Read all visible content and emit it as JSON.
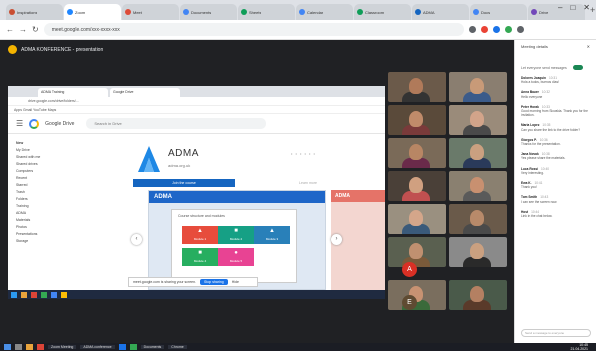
{
  "browser": {
    "tabs": [
      {
        "label": "Inspirations",
        "color": "#c94e32"
      },
      {
        "label": "Zoom",
        "color": "#1f86ff"
      },
      {
        "label": "Meet",
        "color": "#dd4b39"
      },
      {
        "label": "Documents",
        "color": "#4285f4"
      },
      {
        "label": "Sheets",
        "color": "#0f9d58"
      },
      {
        "label": "Calendar",
        "color": "#4285f4"
      },
      {
        "label": "Classroom",
        "color": "#0f9d58"
      },
      {
        "label": "ADMA",
        "color": "#1565c0"
      },
      {
        "label": "Docs",
        "color": "#4285f4"
      },
      {
        "label": "Drive",
        "color": "#7248b9"
      }
    ],
    "url": "meet.google.com/xxx-xxxx-xxx"
  },
  "meet": {
    "title": "ADMA KONFERENCE - presentation",
    "shared": {
      "tabs": [
        "ADMA Training",
        "Google Drive"
      ],
      "url": "drive.google.com/drive/folders/...",
      "bookmarks": "Apps   Gmail   YouTube   Maps",
      "drive_name": "Google Drive",
      "search_placeholder": "Search in Drive",
      "sidebar": [
        "New",
        "My Drive",
        "Shared with me",
        "Shared drives",
        "Computers",
        "Recent",
        "Starred",
        "Trash",
        "Folders",
        "Training",
        "ADMA",
        "Materials",
        "Photos",
        "Presentations",
        "Storage"
      ],
      "brand": "ADMA",
      "brand_sub": "adma.org.uk",
      "stat": "• • • •  • •",
      "primary_button": "Join the course",
      "secondary_button": "Learn more",
      "slide_header": "ADMA",
      "slide_panel_title": "Course structure and modules",
      "tiles": [
        {
          "label": "Module 1",
          "color": "#e74c3c",
          "icon": "▲"
        },
        {
          "label": "Module 2",
          "color": "#16a085",
          "icon": "■"
        },
        {
          "label": "Module 3",
          "color": "#2980b9",
          "icon": "▲"
        },
        {
          "label": "Module 4",
          "color": "#27ae60",
          "icon": "■"
        },
        {
          "label": "Module 5",
          "color": "#e84393",
          "icon": "●"
        }
      ],
      "slide2_header": "ADMA",
      "notif_text": "meet.google.com is sharing your screen.",
      "notif_button": "Stop sharing",
      "notif_hide": "Hide"
    },
    "participants": [
      {
        "skin": "#b07a5a",
        "bg": "#6b5a4a",
        "shirt": "#333"
      },
      {
        "skin": "#c89a78",
        "bg": "#8a7e70",
        "shirt": "#3b5b8a"
      },
      {
        "skin": "#c08b6a",
        "bg": "#5a4a3a",
        "shirt": "#7a3a3a"
      },
      {
        "skin": "#d2a48a",
        "bg": "#9a8b7a",
        "shirt": "#4a4a4a"
      },
      {
        "skin": "#b88664",
        "bg": "#7a6a58",
        "shirt": "#6a2a4a"
      },
      {
        "skin": "#caa080",
        "bg": "#6a7a6a",
        "shirt": "#2a3a5a"
      },
      {
        "skin": "#d0a080",
        "bg": "#4a4038",
        "shirt": "#c05050"
      },
      {
        "skin": "#c89070",
        "bg": "#8a8070",
        "shirt": "#5a5a5a"
      },
      {
        "skin": "#d4a68a",
        "bg": "#9a9080",
        "shirt": "#3a5a7a"
      },
      {
        "skin": "#b88a6a",
        "bg": "#6a5a4a",
        "shirt": "#4a4a4a"
      },
      {
        "skin": "#c09070",
        "bg": "#5a6050",
        "shirt": "#7a5a3a"
      },
      {
        "skin": "#caa080",
        "bg": "#8a8a8a",
        "shirt": "#2a2a2a"
      },
      {
        "skin": "#c89272",
        "bg": "#7a6e5e",
        "shirt": "#3a6a3a"
      },
      {
        "skin": "#b48062",
        "bg": "#4a5a4a",
        "shirt": "#5a3a2a"
      }
    ],
    "avatars": [
      {
        "letter": "A",
        "color": "#d93025"
      },
      {
        "letter": "E",
        "color": "#5f4b32"
      }
    ]
  },
  "chat": {
    "title": "Meeting details",
    "close": "✕",
    "toggle_label": "Let everyone send messages",
    "messages": [
      {
        "name": "Dolores Joaquin",
        "time": "10:31",
        "text": "Hola a todos, buenos días!"
      },
      {
        "name": "Anna Bauer",
        "time": "10:32",
        "text": "Hello everyone"
      },
      {
        "name": "Peter Horak",
        "time": "10:33",
        "text": "Good morning from Slovakia. Thank you for the invitation."
      },
      {
        "name": "Maria Lopez",
        "time": "10:35",
        "text": "Can you share the link to the drive folder?"
      },
      {
        "name": "Giorgos P.",
        "time": "10:36",
        "text": "Thanks for the presentation."
      },
      {
        "name": "Jana Novak",
        "time": "10:38",
        "text": "Yes please share the materials."
      },
      {
        "name": "Luca Rossi",
        "time": "10:40",
        "text": "Very interesting."
      },
      {
        "name": "Ewa K.",
        "time": "10:41",
        "text": "Thank you!"
      },
      {
        "name": "Tom Smith",
        "time": "10:43",
        "text": "I can see the screen now."
      },
      {
        "name": "Host",
        "time": "10:44",
        "text": "Link in the chat below."
      }
    ],
    "input_placeholder": "Send a message to everyone"
  },
  "taskbar": {
    "items": [
      "Zoom Meeting",
      "ADMA conference",
      "Documents",
      "Chrome"
    ],
    "time": "10:45",
    "date": "21.04.2021"
  }
}
